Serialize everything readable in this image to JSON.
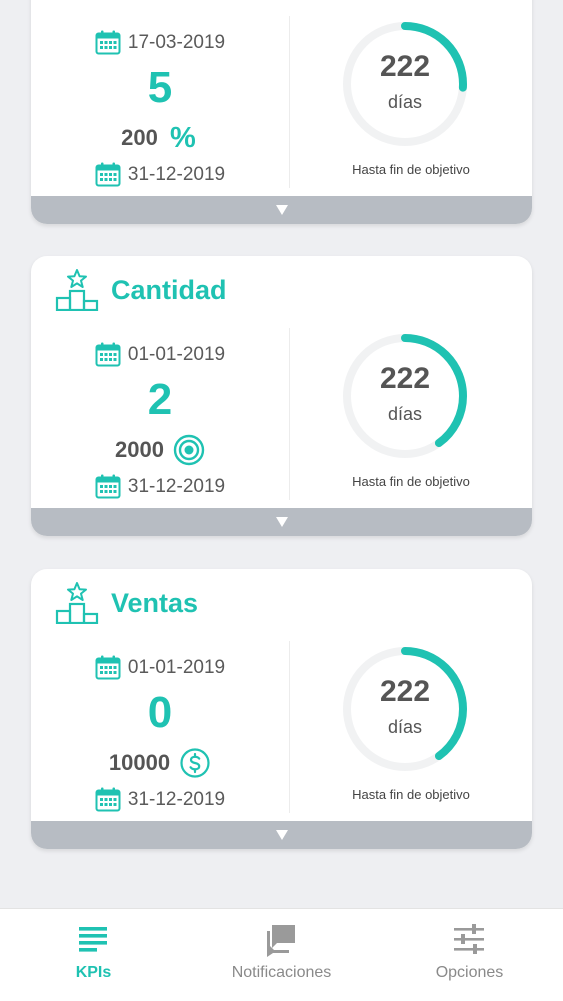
{
  "colors": {
    "accent": "#1fc2b2",
    "ring_track": "#f1f2f3",
    "expand_bar": "#b7bcc3",
    "background": "#eeeff2"
  },
  "cards": [
    {
      "title": "",
      "start_date": "17-03-2019",
      "current_value": "5",
      "target_value": "200",
      "target_icon": "percent-icon",
      "target_glyph": "%",
      "end_date": "31-12-2019",
      "days_remaining": "222",
      "days_label": "días",
      "progress_fraction": 0.26,
      "caption": "Hasta fin de objetivo"
    },
    {
      "title": "Cantidad",
      "start_date": "01-01-2019",
      "current_value": "2",
      "target_value": "2000",
      "target_icon": "target-icon",
      "end_date": "31-12-2019",
      "days_remaining": "222",
      "days_label": "días",
      "progress_fraction": 0.4,
      "caption": "Hasta fin de objetivo"
    },
    {
      "title": "Ventas",
      "start_date": "01-01-2019",
      "current_value": "0",
      "target_value": "10000",
      "target_icon": "dollar-icon",
      "end_date": "31-12-2019",
      "days_remaining": "222",
      "days_label": "días",
      "progress_fraction": 0.4,
      "caption": "Hasta fin de objetivo"
    }
  ],
  "nav": {
    "items": [
      {
        "label": "KPIs",
        "icon": "list-icon",
        "active": true
      },
      {
        "label": "Notificaciones",
        "icon": "chat-icon",
        "active": false
      },
      {
        "label": "Opciones",
        "icon": "sliders-icon",
        "active": false
      }
    ]
  }
}
